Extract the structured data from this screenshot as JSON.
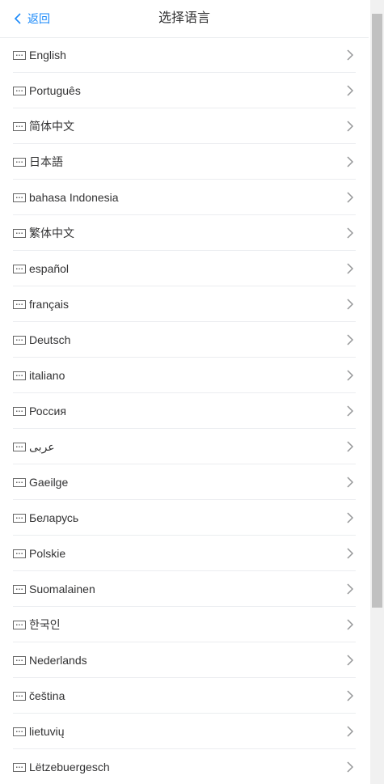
{
  "header": {
    "back_label": "返回",
    "title": "选择语言"
  },
  "languages": [
    {
      "label": "English"
    },
    {
      "label": "Português"
    },
    {
      "label": "简体中文"
    },
    {
      "label": "日本語"
    },
    {
      "label": "bahasa Indonesia"
    },
    {
      "label": "繁体中文"
    },
    {
      "label": "español"
    },
    {
      "label": "français"
    },
    {
      "label": "Deutsch"
    },
    {
      "label": "italiano"
    },
    {
      "label": "Россия"
    },
    {
      "label": "عربى"
    },
    {
      "label": "Gaeilge"
    },
    {
      "label": "Беларусь"
    },
    {
      "label": "Polskie"
    },
    {
      "label": "Suomalainen"
    },
    {
      "label": "한국인"
    },
    {
      "label": "Nederlands"
    },
    {
      "label": "čeština"
    },
    {
      "label": "lietuvių"
    },
    {
      "label": "Lëtzebuergesch"
    }
  ],
  "icons": {
    "back": "chevron-left-icon",
    "row": "keyboard-icon",
    "arrow": "chevron-right-icon"
  },
  "colors": {
    "accent": "#1989fa",
    "text": "#323233",
    "divider": "#ebedf0",
    "arrow": "#969799"
  }
}
